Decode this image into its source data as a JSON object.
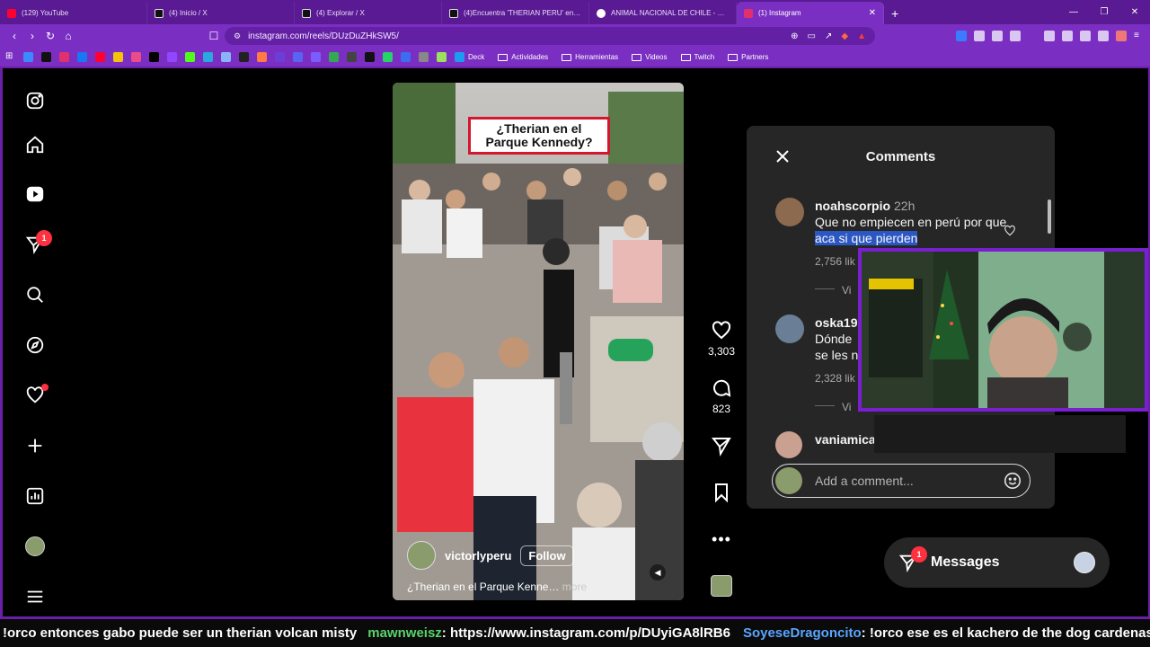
{
  "browser": {
    "tabs": [
      {
        "title": "(129) YouTube",
        "favicon_color": "#ff0033"
      },
      {
        "title": "(4) Inicio / X",
        "favicon_color": "#000000"
      },
      {
        "title": "(4) Explorar / X",
        "favicon_color": "#000000"
      },
      {
        "title": "(4)Encuentra 'THERIAN PERU' en TikTok",
        "favicon_color": "#000000"
      },
      {
        "title": "ANIMAL NACIONAL DE CHILE - Google",
        "favicon_color": "#ffffff"
      },
      {
        "title": "(1) Instagram",
        "favicon_color": "#e1306c",
        "active": true
      }
    ],
    "url": "instagram.com/reels/DUzDuZHkSW5/",
    "bookmark_folders": [
      "Deck",
      "Actividades",
      "Herramientas",
      "Videos",
      "Twitch",
      "Partners"
    ]
  },
  "sidebar": {
    "items": [
      "instagram-logo-icon",
      "home-icon",
      "reels-icon",
      "direct-icon",
      "search-icon",
      "explore-icon",
      "notifications-icon",
      "create-icon",
      "dashboard-icon",
      "profile-avatar",
      "menu-icon"
    ],
    "direct_badge": "1"
  },
  "reel": {
    "overlay_text": "¿Therian en el Parque Kennedy?",
    "author": "victorlyperu",
    "follow_label": "Follow",
    "caption": "¿Therian en el Parque Kenne…",
    "more_label": "more",
    "likes": "3,303",
    "comments": "823"
  },
  "comments": {
    "title": "Comments",
    "items": [
      {
        "user": "noahscorpio",
        "time": "22h",
        "text_before": "Que no empiecen en perú por que ",
        "text_highlight": "aca si que pierden",
        "likes": "2,756 lik",
        "view": "Vi"
      },
      {
        "user": "oska199",
        "time": "",
        "text_line1": "Dónde",
        "text_line2": "se les n",
        "likes": "2,328 lik",
        "view": "Vi"
      },
      {
        "user": "vaniamicad",
        "time": ""
      }
    ],
    "add_placeholder": "Add a comment..."
  },
  "messages": {
    "label": "Messages",
    "badge": "1"
  },
  "stream_overlay": {
    "chat": [
      {
        "text": "!orco entonces gabo puede ser un therian volcan misty",
        "user": ""
      },
      {
        "user": "mawnweisz",
        "text": ": https://www.instagram.com/p/DUyiGA8lRB6"
      },
      {
        "user": "SoyeseDragoncito",
        "text": ": !orco ese es el kachero de the dog cardenas"
      }
    ]
  }
}
